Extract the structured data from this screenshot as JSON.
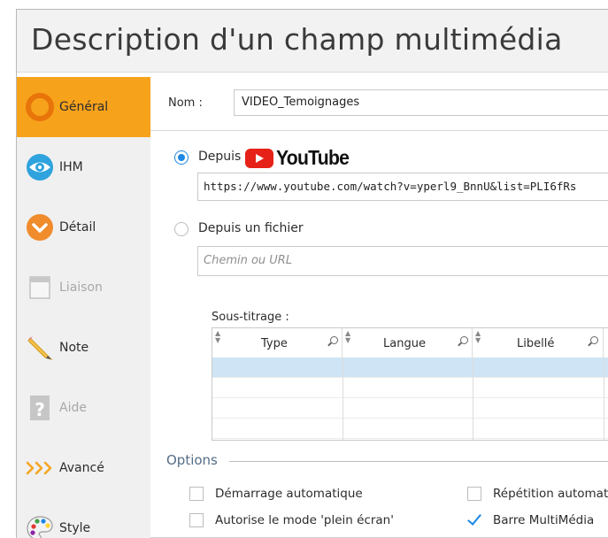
{
  "window": {
    "title": "Description d'un champ multimédia"
  },
  "sidebar": {
    "items": [
      {
        "label": "Général",
        "icon": "general-ring-icon",
        "active": true
      },
      {
        "label": "IHM",
        "icon": "eye-icon"
      },
      {
        "label": "Détail",
        "icon": "detail-chevron-icon"
      },
      {
        "label": "Liaison",
        "icon": "link-window-icon",
        "disabled": true
      },
      {
        "label": "Note",
        "icon": "pencil-icon"
      },
      {
        "label": "Aide",
        "icon": "help-question-icon",
        "disabled": true
      },
      {
        "label": "Avancé",
        "icon": "advanced-chevrons-icon"
      },
      {
        "label": "Style",
        "icon": "palette-icon"
      }
    ]
  },
  "form": {
    "name_label": "Nom :",
    "name_value": "VIDEO_Temoignages",
    "source_youtube_label": "Depuis",
    "youtube_logo_text": "YouTube",
    "youtube_url": "https://www.youtube.com/watch?v=yperl9_BnnU&list=PLI6fRs",
    "source_file_label": "Depuis un fichier",
    "file_placeholder": "Chemin ou URL"
  },
  "subtitles": {
    "label": "Sous-titrage :",
    "columns": [
      "Type",
      "Langue",
      "Libellé"
    ],
    "rows": [
      [
        "",
        "",
        ""
      ],
      [
        "",
        "",
        ""
      ],
      [
        "",
        "",
        ""
      ],
      [
        "",
        "",
        ""
      ]
    ]
  },
  "options": {
    "title": "Options",
    "autostart_label": "Démarrage automatique",
    "autostart_checked": false,
    "repeat_label": "Répétition automatique",
    "repeat_checked": false,
    "fullscreen_label": "Autorise le mode 'plein écran'",
    "fullscreen_checked": false,
    "mediabar_label": "Barre MultiMédia",
    "mediabar_checked": true
  },
  "colors": {
    "accent": "#f7a21b",
    "selection": "#1e88e5",
    "youtube_red": "#e62117"
  }
}
